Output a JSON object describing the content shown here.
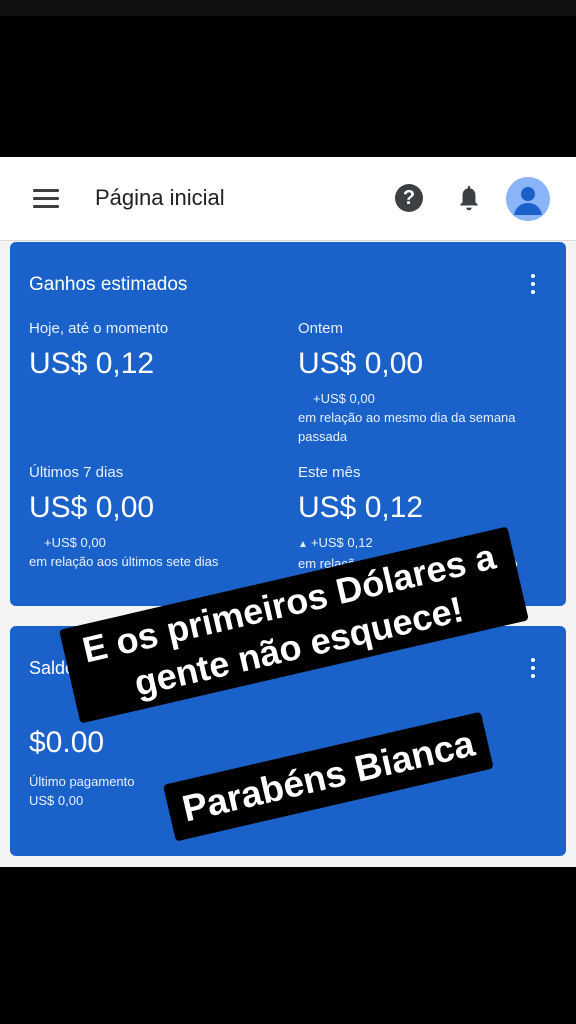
{
  "header": {
    "title": "Página inicial",
    "icons": [
      "menu-icon",
      "help-icon",
      "notifications-bell-icon",
      "account-avatar-icon"
    ]
  },
  "colors": {
    "card_blue": "#1a62c9",
    "appbar": "#ffffff",
    "background": "#000000"
  },
  "earnings": {
    "title": "Ganhos estimados",
    "today": {
      "label": "Hoje, até o momento",
      "value": "US$ 0,12"
    },
    "yesterday": {
      "label": "Ontem",
      "value": "US$ 0,00",
      "delta": "+US$ 0,00",
      "comparison": "em relação ao mesmo dia da semana passada"
    },
    "last7": {
      "label": "Últimos 7 dias",
      "value": "US$ 0,00",
      "delta": "+US$ 0,00",
      "comparison": "em relação aos últimos sete dias"
    },
    "month": {
      "label": "Este mês",
      "value": "US$ 0,12",
      "delta": "+US$ 0,12",
      "comparison": "em relação ao mesmo período do ano passado"
    }
  },
  "balance": {
    "title": "Saldo",
    "value": "$0.00",
    "last_payment_label": "Último pagamento",
    "last_payment_value": "US$ 0,00"
  },
  "overlay": {
    "line1": "E os primeiros Dólares a",
    "line2": "gente não esquece!",
    "line3": "Parabéns Bianca"
  }
}
